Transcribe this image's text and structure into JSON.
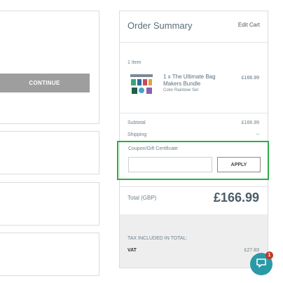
{
  "checkout": {
    "continue_label": "CONTINUE"
  },
  "order_summary": {
    "title": "Order Summary",
    "edit_cart": "Edit Cart",
    "item_count": "1 Item",
    "product": {
      "name": "1 x The Ultimate Bag Makers Bundle",
      "variant": "Color Rainbow Set",
      "price": "£166.99"
    },
    "subtotal_label": "Subtotal",
    "subtotal_value": "£166.99",
    "shipping_label": "Shipping",
    "shipping_value": "--",
    "coupon_label": "Coupon/Gift Certificate",
    "coupon_value": "",
    "apply_label": "APPLY",
    "total_label": "Total (GBP)",
    "total_value": "£166.99",
    "tax_heading": "TAX INCLUDED IN TOTAL:",
    "vat_label": "VAT",
    "vat_value": "£27.83"
  },
  "chat": {
    "badge_count": "1",
    "icon": "chat-bubble-icon"
  },
  "colors": {
    "highlight": "#2aad4a",
    "chat": "#2b9aa7",
    "badge": "#c0392b"
  }
}
